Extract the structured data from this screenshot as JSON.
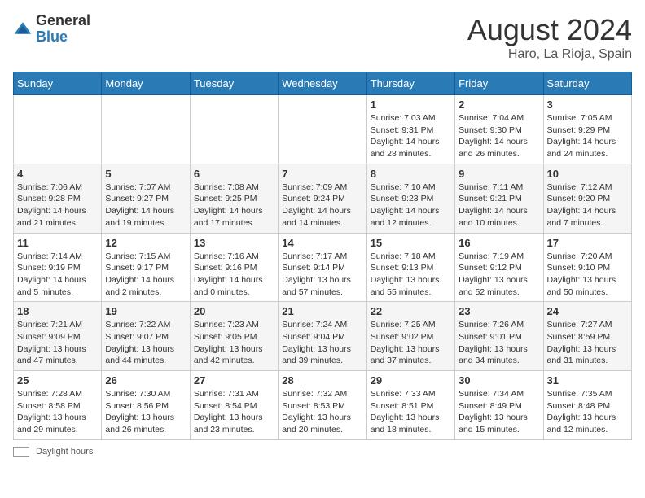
{
  "header": {
    "logo_general": "General",
    "logo_blue": "Blue",
    "title": "August 2024",
    "location": "Haro, La Rioja, Spain"
  },
  "weekdays": [
    "Sunday",
    "Monday",
    "Tuesday",
    "Wednesday",
    "Thursday",
    "Friday",
    "Saturday"
  ],
  "weeks": [
    [
      {
        "day": "",
        "info": ""
      },
      {
        "day": "",
        "info": ""
      },
      {
        "day": "",
        "info": ""
      },
      {
        "day": "",
        "info": ""
      },
      {
        "day": "1",
        "info": "Sunrise: 7:03 AM\nSunset: 9:31 PM\nDaylight: 14 hours and 28 minutes."
      },
      {
        "day": "2",
        "info": "Sunrise: 7:04 AM\nSunset: 9:30 PM\nDaylight: 14 hours and 26 minutes."
      },
      {
        "day": "3",
        "info": "Sunrise: 7:05 AM\nSunset: 9:29 PM\nDaylight: 14 hours and 24 minutes."
      }
    ],
    [
      {
        "day": "4",
        "info": "Sunrise: 7:06 AM\nSunset: 9:28 PM\nDaylight: 14 hours and 21 minutes."
      },
      {
        "day": "5",
        "info": "Sunrise: 7:07 AM\nSunset: 9:27 PM\nDaylight: 14 hours and 19 minutes."
      },
      {
        "day": "6",
        "info": "Sunrise: 7:08 AM\nSunset: 9:25 PM\nDaylight: 14 hours and 17 minutes."
      },
      {
        "day": "7",
        "info": "Sunrise: 7:09 AM\nSunset: 9:24 PM\nDaylight: 14 hours and 14 minutes."
      },
      {
        "day": "8",
        "info": "Sunrise: 7:10 AM\nSunset: 9:23 PM\nDaylight: 14 hours and 12 minutes."
      },
      {
        "day": "9",
        "info": "Sunrise: 7:11 AM\nSunset: 9:21 PM\nDaylight: 14 hours and 10 minutes."
      },
      {
        "day": "10",
        "info": "Sunrise: 7:12 AM\nSunset: 9:20 PM\nDaylight: 14 hours and 7 minutes."
      }
    ],
    [
      {
        "day": "11",
        "info": "Sunrise: 7:14 AM\nSunset: 9:19 PM\nDaylight: 14 hours and 5 minutes."
      },
      {
        "day": "12",
        "info": "Sunrise: 7:15 AM\nSunset: 9:17 PM\nDaylight: 14 hours and 2 minutes."
      },
      {
        "day": "13",
        "info": "Sunrise: 7:16 AM\nSunset: 9:16 PM\nDaylight: 14 hours and 0 minutes."
      },
      {
        "day": "14",
        "info": "Sunrise: 7:17 AM\nSunset: 9:14 PM\nDaylight: 13 hours and 57 minutes."
      },
      {
        "day": "15",
        "info": "Sunrise: 7:18 AM\nSunset: 9:13 PM\nDaylight: 13 hours and 55 minutes."
      },
      {
        "day": "16",
        "info": "Sunrise: 7:19 AM\nSunset: 9:12 PM\nDaylight: 13 hours and 52 minutes."
      },
      {
        "day": "17",
        "info": "Sunrise: 7:20 AM\nSunset: 9:10 PM\nDaylight: 13 hours and 50 minutes."
      }
    ],
    [
      {
        "day": "18",
        "info": "Sunrise: 7:21 AM\nSunset: 9:09 PM\nDaylight: 13 hours and 47 minutes."
      },
      {
        "day": "19",
        "info": "Sunrise: 7:22 AM\nSunset: 9:07 PM\nDaylight: 13 hours and 44 minutes."
      },
      {
        "day": "20",
        "info": "Sunrise: 7:23 AM\nSunset: 9:05 PM\nDaylight: 13 hours and 42 minutes."
      },
      {
        "day": "21",
        "info": "Sunrise: 7:24 AM\nSunset: 9:04 PM\nDaylight: 13 hours and 39 minutes."
      },
      {
        "day": "22",
        "info": "Sunrise: 7:25 AM\nSunset: 9:02 PM\nDaylight: 13 hours and 37 minutes."
      },
      {
        "day": "23",
        "info": "Sunrise: 7:26 AM\nSunset: 9:01 PM\nDaylight: 13 hours and 34 minutes."
      },
      {
        "day": "24",
        "info": "Sunrise: 7:27 AM\nSunset: 8:59 PM\nDaylight: 13 hours and 31 minutes."
      }
    ],
    [
      {
        "day": "25",
        "info": "Sunrise: 7:28 AM\nSunset: 8:58 PM\nDaylight: 13 hours and 29 minutes."
      },
      {
        "day": "26",
        "info": "Sunrise: 7:30 AM\nSunset: 8:56 PM\nDaylight: 13 hours and 26 minutes."
      },
      {
        "day": "27",
        "info": "Sunrise: 7:31 AM\nSunset: 8:54 PM\nDaylight: 13 hours and 23 minutes."
      },
      {
        "day": "28",
        "info": "Sunrise: 7:32 AM\nSunset: 8:53 PM\nDaylight: 13 hours and 20 minutes."
      },
      {
        "day": "29",
        "info": "Sunrise: 7:33 AM\nSunset: 8:51 PM\nDaylight: 13 hours and 18 minutes."
      },
      {
        "day": "30",
        "info": "Sunrise: 7:34 AM\nSunset: 8:49 PM\nDaylight: 13 hours and 15 minutes."
      },
      {
        "day": "31",
        "info": "Sunrise: 7:35 AM\nSunset: 8:48 PM\nDaylight: 13 hours and 12 minutes."
      }
    ]
  ],
  "footer": {
    "daylight_label": "Daylight hours"
  }
}
